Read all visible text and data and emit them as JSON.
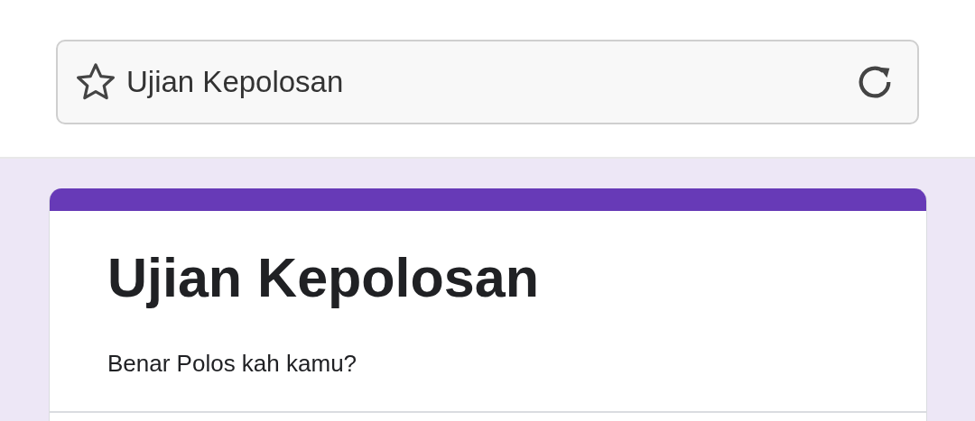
{
  "address_bar": {
    "value": "Ujian Kepolosan"
  },
  "form": {
    "title": "Ujian Kepolosan",
    "description": "Benar Polos kah kamu?"
  }
}
